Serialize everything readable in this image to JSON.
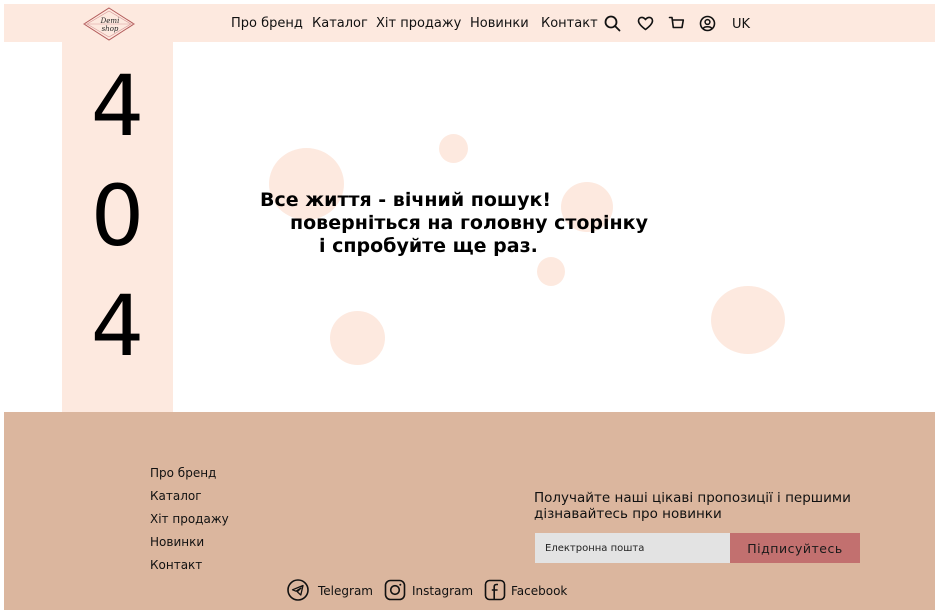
{
  "header": {
    "logo_text_line1": "Demi",
    "logo_text_line2": "shop",
    "nav": [
      {
        "label": "Про бренд"
      },
      {
        "label": "Каталог"
      },
      {
        "label": "Хіт продажу"
      },
      {
        "label": "Новинки"
      },
      {
        "label": "Контакт"
      }
    ],
    "icons": [
      "search-icon",
      "heart-icon",
      "cart-icon",
      "user-icon"
    ],
    "language": "UK"
  },
  "error": {
    "digits": [
      "4",
      "0",
      "4"
    ],
    "line1": "Все життя - вічний пошук!",
    "line2": "поверніться на головну сторінку",
    "line3": "і спробуйте ще раз."
  },
  "footer": {
    "links": [
      {
        "label": "Про бренд"
      },
      {
        "label": "Каталог"
      },
      {
        "label": "Хіт продажу"
      },
      {
        "label": "Новинки"
      },
      {
        "label": "Контакт"
      }
    ],
    "subscribe_text": "Получайте наші цікаві пропозиції і першими дізнавайтесь про новинки",
    "email_placeholder": "Електронна пошта",
    "subscribe_button": "Підписуйтесь",
    "social": [
      {
        "label": "Telegram",
        "icon": "telegram-icon"
      },
      {
        "label": "Instagram",
        "icon": "instagram-icon"
      },
      {
        "label": "Facebook",
        "icon": "facebook-icon"
      }
    ]
  },
  "colors": {
    "header_bg": "#fde9df",
    "footer_bg": "#dbb69e",
    "button_bg": "#c2706f",
    "input_bg": "#e3e3e3"
  }
}
